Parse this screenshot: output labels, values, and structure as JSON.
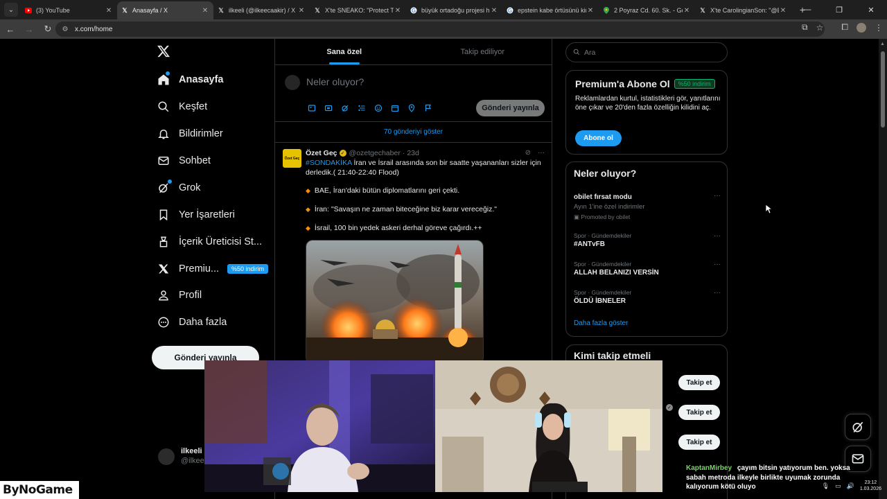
{
  "browser": {
    "tabs": [
      {
        "title": "(3) YouTube",
        "icon": "youtube-icon",
        "color": "#ff0000"
      },
      {
        "title": "Anasayfa / X",
        "icon": "x-logo-icon",
        "active": true
      },
      {
        "title": "ilkeeli (@ilkeecaakir) / X",
        "icon": "x-logo-icon"
      },
      {
        "title": "X'te SNEAKO: \"Protect Tu",
        "icon": "x-logo-icon"
      },
      {
        "title": "büyük ortadoğu projesi h",
        "icon": "google-icon"
      },
      {
        "title": "epstein kabe örtüsünü kin",
        "icon": "google-icon"
      },
      {
        "title": "2 Poyraz Cd. 60. Sk. - Goo",
        "icon": "maps-pin-icon"
      },
      {
        "title": "X'te CarolingianSon: \"@El",
        "icon": "x-logo-icon"
      }
    ],
    "url": "x.com/home"
  },
  "nav": {
    "items": [
      {
        "label": "Anasayfa",
        "icon": "home-icon",
        "bold": true
      },
      {
        "label": "Keşfet",
        "icon": "search-icon"
      },
      {
        "label": "Bildirimler",
        "icon": "bell-icon"
      },
      {
        "label": "Sohbet",
        "icon": "mail-icon"
      },
      {
        "label": "Grok",
        "icon": "grok-icon"
      },
      {
        "label": "Yer İşaretleri",
        "icon": "bookmark-icon"
      },
      {
        "label": "İçerik Üreticisi St...",
        "icon": "creator-studio-icon"
      },
      {
        "label": "Premiu...",
        "icon": "x-premium-icon"
      },
      {
        "label": "Profil",
        "icon": "profile-icon"
      },
      {
        "label": "Daha fazla",
        "icon": "more-circle-icon"
      }
    ],
    "premium_badge": "%50 indirim",
    "post_button": "Gönderi yayınla",
    "account": {
      "name": "ilkeeli",
      "handle": "@ilkeec"
    }
  },
  "timeline": {
    "tabs": [
      "Sana özel",
      "Takip ediliyor"
    ],
    "compose_placeholder": "Neler oluyor?",
    "compose_button": "Gönderi yayınla",
    "show_more": "70 gönderiyi göster",
    "tweet": {
      "author": "Özet Geç",
      "avatar_text": "Özet Geç",
      "handle": "@ozetgechaber",
      "time": "23d",
      "hashtag": "#SONDAKİKA",
      "text": "İran ve İsrail arasında son bir saatte yaşananları sizler için derledik.( 21:40-22:40 Flood)",
      "bullets": [
        "BAE, İran'daki bütün diplomatlarını geri çekti.",
        "İran: \"Savaşın ne zaman biteceğine biz karar vereceğiz.\"",
        "İsrail, 100 bin yedek askeri derhal göreve çağırdı.++"
      ]
    }
  },
  "sidebar": {
    "search_placeholder": "Ara",
    "premium": {
      "title": "Premium'a Abone Ol",
      "badge": "%50 indirim",
      "description": "Reklamlardan kurtul, istatistikleri gör, yanıtlarını öne çıkar ve 20'den fazla özelliğin kilidini aç.",
      "button": "Abone ol"
    },
    "trends": {
      "title": "Neler oluyor?",
      "items": [
        {
          "context": "",
          "name": "obilet fırsat modu",
          "sub": "Ayın 1'ine özel indirimler",
          "promo": "Promoted by obilet"
        },
        {
          "context": "Spor · Gündemdekiler",
          "name": "#ANTvFB"
        },
        {
          "context": "Spor · Gündemdekiler",
          "name": "ALLAH BELANIZI VERSİN"
        },
        {
          "context": "Spor · Gündemdekiler",
          "name": "ÖLDÜ İBNELER"
        }
      ],
      "show_more": "Daha fazla göster"
    },
    "who_to_follow": {
      "title": "Kimi takip etmeli",
      "follow_label": "Takip et"
    }
  },
  "overlay": {
    "logo": "ByNoGame",
    "chat_user": "KaptanMirbey",
    "chat_message": "çayım bitsin yatıyorum ben. yoksa sabah metroda ilkeyle birlikte uyumak zorunda kalıyorum kötü oluyo",
    "time": "23:12",
    "date": "1.03.2026"
  },
  "colors": {
    "accent": "#1d9bf0",
    "border": "#2f3336",
    "muted": "#71767b",
    "chat_user": "#7cd36b"
  }
}
